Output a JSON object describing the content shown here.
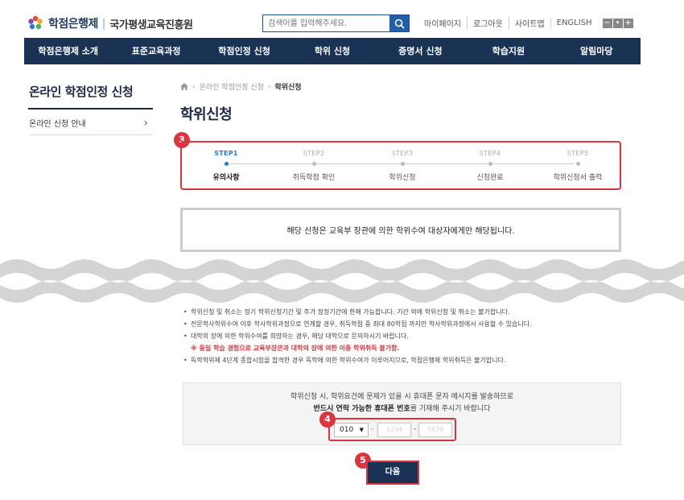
{
  "header": {
    "brand": "학점은행제",
    "separator": "|",
    "org": "국가평생교육진흥원",
    "search_placeholder": "검색어를 입력해주세요.",
    "util_links": [
      "마이페이지",
      "로그아웃",
      "사이트맵",
      "ENGLISH"
    ],
    "zoom": [
      "−",
      "•",
      "+"
    ]
  },
  "gnb": [
    "학점은행제 소개",
    "표준교육과정",
    "학점인정 신청",
    "학위 신청",
    "증명서 신청",
    "학습지원",
    "알림마당"
  ],
  "lnb": {
    "title": "온라인 학점인정 신청",
    "items": [
      {
        "label": "온라인 신청 안내",
        "arrow": "›"
      }
    ]
  },
  "breadcrumb": {
    "items": [
      "온라인 학점인정 신청",
      "학위신청"
    ],
    "sep": "›"
  },
  "page_title": "학위신청",
  "steps": [
    {
      "num": "STEP1",
      "label": "유의사항",
      "active": true
    },
    {
      "num": "STEP2",
      "label": "취득학점 확인",
      "active": false
    },
    {
      "num": "STEP3",
      "label": "학위신청",
      "active": false
    },
    {
      "num": "STEP4",
      "label": "신청완료",
      "active": false
    },
    {
      "num": "STEP5",
      "label": "학위신청서 출력",
      "active": false
    }
  ],
  "badges": {
    "b3": "3",
    "b4": "4",
    "b5": "5"
  },
  "notice": "해당 신청은 교육부 장관에 의한 학위수여 대상자에게만 해당됩니다.",
  "info": {
    "items": [
      "학위신청 및 취소는 정기 학위신청기간 및 추가 정정기간에 한해 가능합니다. 기간 외에 학위신청 및 취소는 불가합니다.",
      "전문학사학위수여 이후 학사학위과정으로 연계할 경우, 취득학점 중 최대 80학점 까지만 학사학위과정에서 사용할 수 있습니다.",
      "대학의 장에 의한 학위수여를 희망하는 경우, 해당 대학으로 문의하시기 바랍니다."
    ],
    "warn": "※ 동일 학습 경험으로 교육부장관과 대학의 장에 의한 이중 학위취득 불가함.",
    "last": "독학학위제 4단계 종합시험을 합격한 경우 독학에 의한 학위수여가 이루어지므로, 학점은행제 학위취득은 불가합니다."
  },
  "phone": {
    "msg1": "학위신청 시, 학위요건에 문제가 있을 시 휴대폰 문자 메시지를 발송하므로",
    "msg2_bold": "반드시 연락 가능한 휴대폰 번호",
    "msg2_rest": "를 기재해 주시기 바랍니다",
    "prefix": "010",
    "caret": "▼",
    "dash": "-",
    "middle": "1234",
    "last": "5678"
  },
  "next_label": "다음",
  "colors": {
    "navy": "#1a3355",
    "highlight": "#d9353f",
    "step_active": "#2d7bc4"
  }
}
